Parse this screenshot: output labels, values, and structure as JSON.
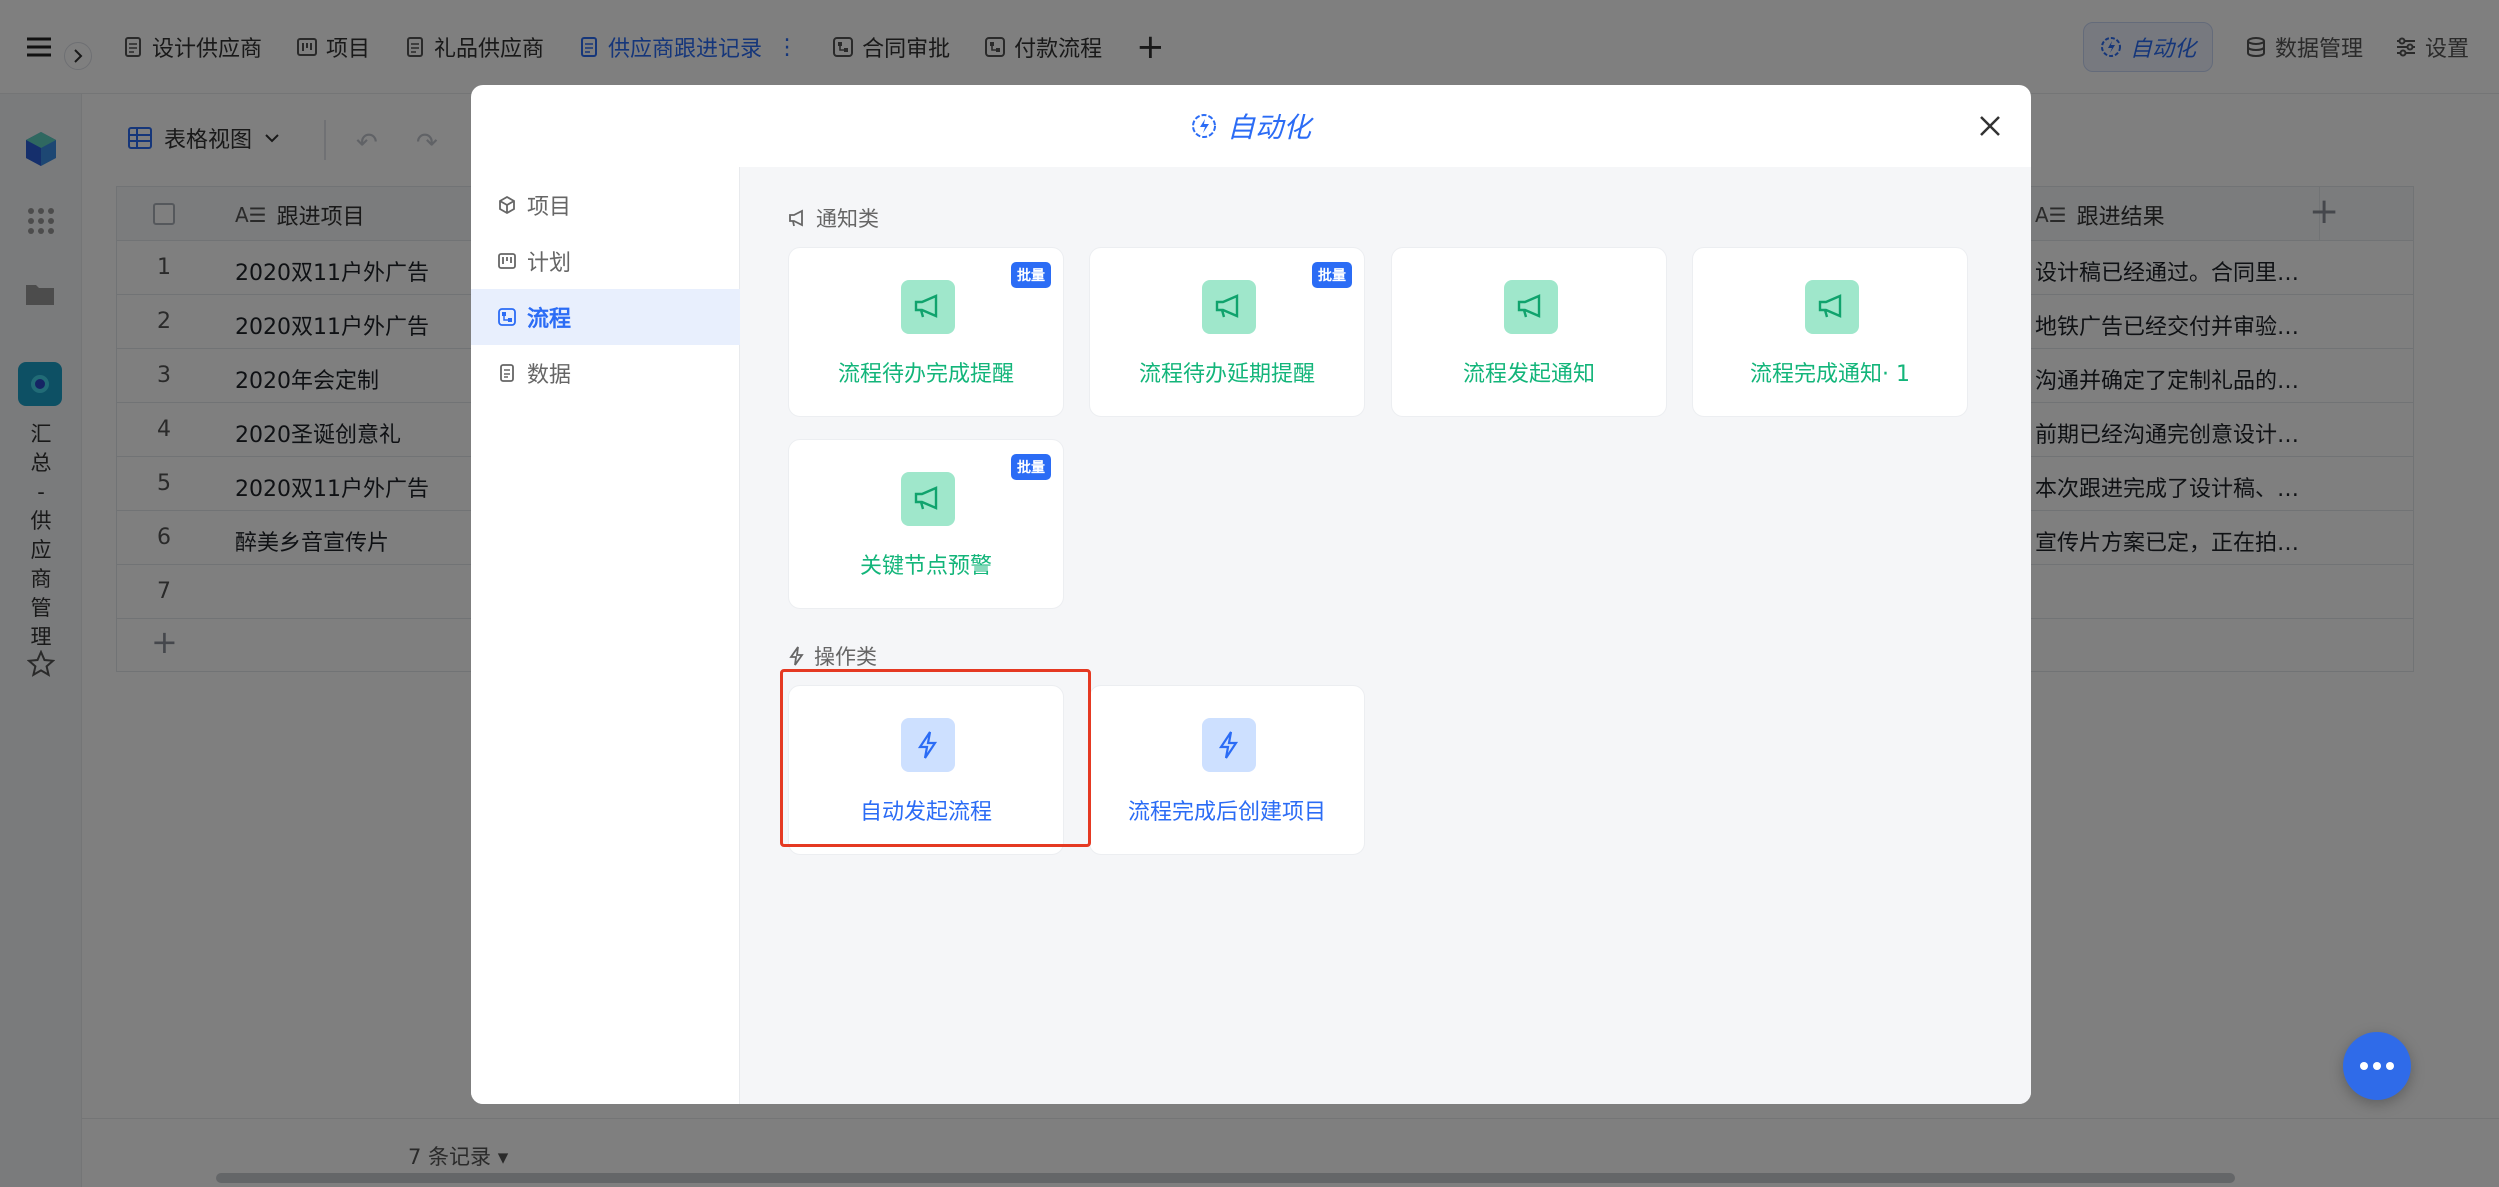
{
  "topbar": {
    "tabs": [
      {
        "label": "设计供应商",
        "icon": "doc-icon"
      },
      {
        "label": "项目",
        "icon": "board-icon"
      },
      {
        "label": "礼品供应商",
        "icon": "doc-icon"
      },
      {
        "label": "供应商跟进记录",
        "icon": "doc-icon",
        "active": true
      },
      {
        "label": "合同审批",
        "icon": "flow-icon"
      },
      {
        "label": "付款流程",
        "icon": "flow-icon"
      }
    ],
    "tab_more": "⋮",
    "automation_label": "自动化",
    "data_manage_label": "数据管理",
    "settings_label": "设置"
  },
  "sidebar": {
    "app_name_chars": [
      "汇",
      "总",
      "-",
      "供",
      "应",
      "商",
      "管",
      "理"
    ]
  },
  "toolbar": {
    "view_label": "表格视图"
  },
  "grid": {
    "col1_header": "跟进项目",
    "col2_header": "跟进结果",
    "rows": [
      {
        "num": "1",
        "project": "2020双11户外广告",
        "result": "设计稿已经通过。合同里…"
      },
      {
        "num": "2",
        "project": "2020双11户外广告",
        "result": "地铁广告已经交付并审验…"
      },
      {
        "num": "3",
        "project": "2020年会定制",
        "result": "沟通并确定了定制礼品的…"
      },
      {
        "num": "4",
        "project": "2020圣诞创意礼",
        "result": "前期已经沟通完创意设计…"
      },
      {
        "num": "5",
        "project": "2020双11户外广告",
        "result": "本次跟进完成了设计稿、…"
      },
      {
        "num": "6",
        "project": "醉美乡音宣传片",
        "result": "宣传片方案已定，正在拍…"
      },
      {
        "num": "7",
        "project": "",
        "result": ""
      }
    ]
  },
  "footer": {
    "record_count": "7 条记录"
  },
  "modal": {
    "title": "自动化",
    "sidebar": [
      {
        "label": "项目",
        "icon": "cube-icon"
      },
      {
        "label": "计划",
        "icon": "board-icon"
      },
      {
        "label": "流程",
        "icon": "flow-icon",
        "active": true
      },
      {
        "label": "数据",
        "icon": "doc-icon"
      }
    ],
    "notify_section": "通知类",
    "notify_cards": [
      {
        "label": "流程待办完成提醒",
        "badge": "批量"
      },
      {
        "label": "流程待办延期提醒",
        "badge": "批量"
      },
      {
        "label": "流程发起通知",
        "badge": ""
      },
      {
        "label": "流程完成通知· 1",
        "badge": ""
      },
      {
        "label": "关键节点预警",
        "badge": "批量"
      }
    ],
    "action_section": "操作类",
    "action_cards": [
      {
        "label": "自动发起流程"
      },
      {
        "label": "流程完成后创建项目"
      }
    ]
  },
  "colors": {
    "accent": "#2b6cf5",
    "notify_green": "#13b57a",
    "highlight_red": "#e53922"
  }
}
